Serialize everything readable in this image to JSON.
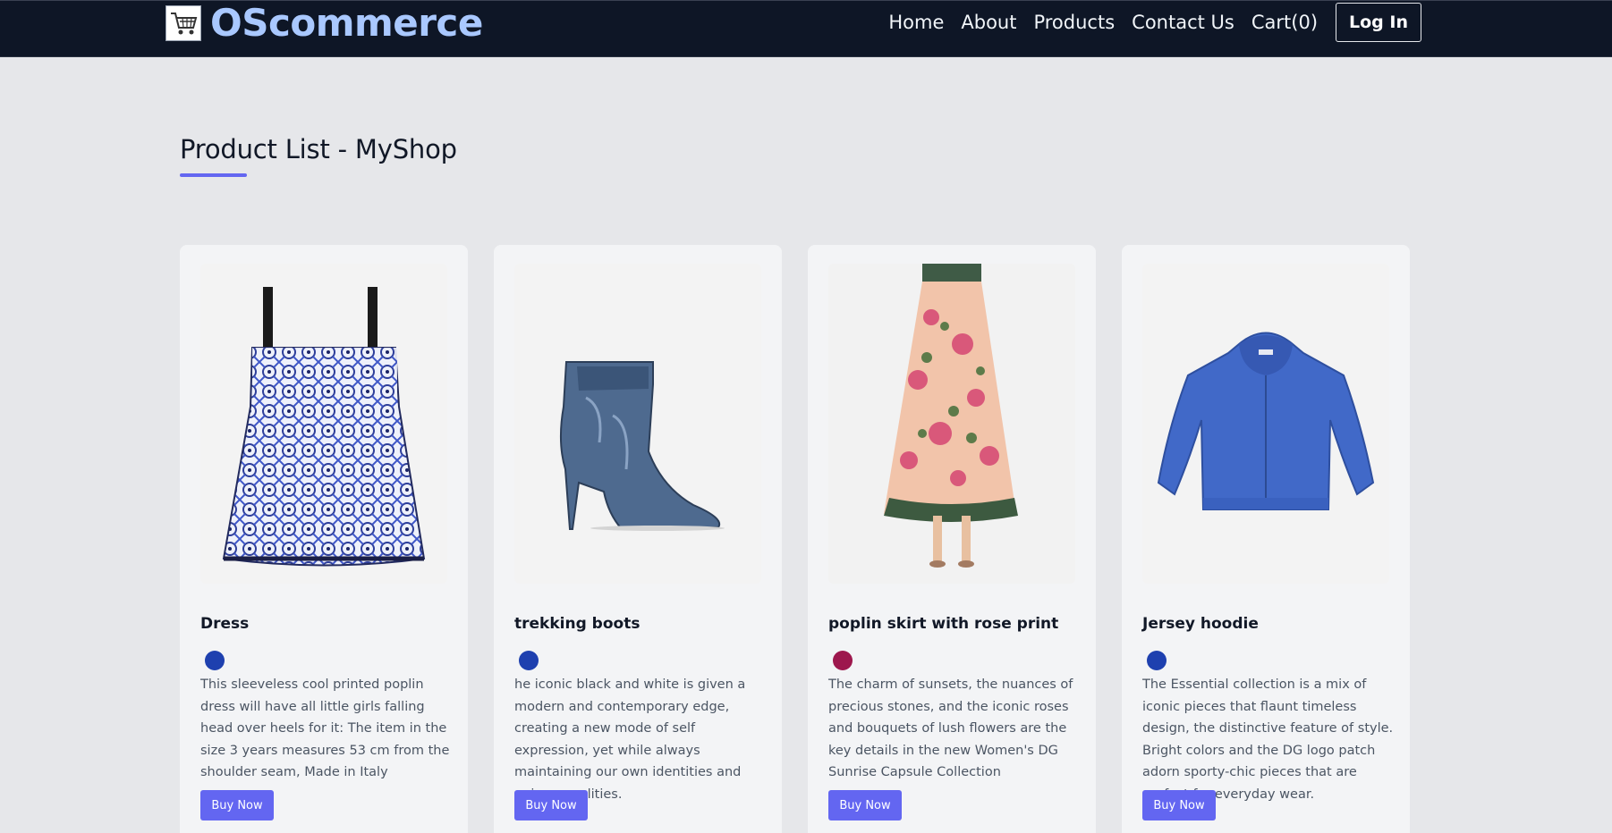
{
  "header": {
    "brand": "OScommerce",
    "nav": [
      "Home",
      "About",
      "Products",
      "Contact Us",
      "Cart(0)"
    ],
    "login": "Log In"
  },
  "page": {
    "title": "Product List - MyShop"
  },
  "accent_color": "#6366f1",
  "products": [
    {
      "name": "Dress",
      "color": "#1e40af",
      "description": "This sleeveless cool printed poplin dress will have all little girls falling head over heels for it: The item in the size 3 years measures 53 cm from the shoulder seam, Made in Italy",
      "button": "Buy Now"
    },
    {
      "name": "trekking boots",
      "color": "#1e40af",
      "description": "he iconic black and white is given a modern and contemporary edge, creating a new mode of self expression, yet while always maintaining our own identities and unique qualities.",
      "button": "Buy Now"
    },
    {
      "name": "poplin skirt with rose print",
      "color": "#9d174d",
      "description": "The charm of sunsets, the nuances of precious stones, and the iconic roses and bouquets of lush flowers are the key details in the new Women's DG Sunrise Capsule Collection",
      "button": "Buy Now"
    },
    {
      "name": "Jersey hoodie",
      "color": "#1e40af",
      "description": "The Essential collection is a mix of iconic pieces that flaunt timeless design, the distinctive feature of style. Bright colors and the DG logo patch adorn sporty-chic pieces that are perfect for everyday wear.",
      "button": "Buy Now"
    }
  ]
}
